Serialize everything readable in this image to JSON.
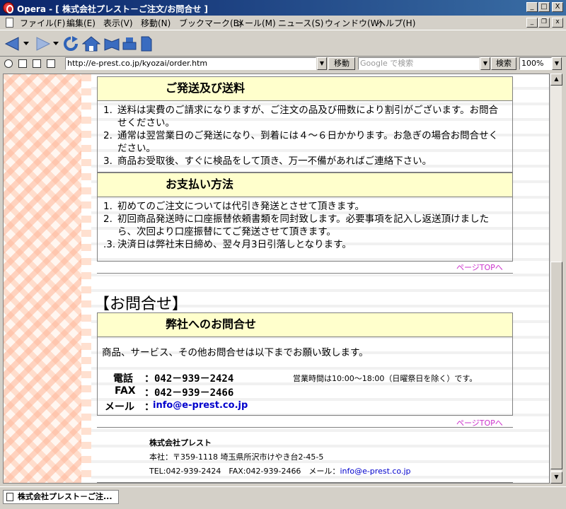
{
  "window": {
    "title": "Opera - [ 株式会社プレスト－ご注文/お問合せ ]",
    "controls": {
      "minimize": "_",
      "maximize": "□",
      "close": "X"
    }
  },
  "menu": {
    "items": [
      "ファイル(F)",
      "編集(E)",
      "表示(V)",
      "移動(N)",
      "ブックマーク(B)",
      "メール(M)",
      "ニュース(S)",
      "ウィンドウ(W)",
      "ヘルプ(H)"
    ]
  },
  "address_bar": {
    "url": "http://e-prest.co.jp/kyozai/order.htm",
    "go_label": "移動",
    "search_placeholder": "Google で検索",
    "search_label": "検索",
    "zoom": "100%"
  },
  "shipping": {
    "heading": "ご発送及び送料",
    "items": [
      {
        "num": "1.",
        "text": "送料は実費のご請求になりますが、ご注文の品及び冊数により割引がございます。お問合せください。"
      },
      {
        "num": "2.",
        "text": "通常は翌営業日のご発送になり、到着には４～６日かかります。お急ぎの場合お問合せください。"
      },
      {
        "num": "3.",
        "text": "商品お受取後、すぐに検品をして頂き、万一不備があればご連絡下さい。"
      }
    ]
  },
  "payment": {
    "heading": "お支払い方法",
    "items": [
      {
        "num": "1.",
        "text": "初めてのご注文については代引き発送とさせて頂きます。"
      },
      {
        "num": "2.",
        "text": "初回商品発送時に口座振替依頼書類を同封致します。必要事項を記入し返送頂けましたら、次回より口座振替にてご発送させて頂きます。"
      },
      {
        "num": ".3.",
        "text": "決済日は弊社末日締め、翌々月3日引落しとなります。"
      }
    ]
  },
  "page_top_label": "ページTOPへ",
  "inquiry": {
    "section_title": "【お問合せ】",
    "heading": "弊社へのお問合せ",
    "intro": "商品、サービス、その他お問合せは以下までお願い致します。",
    "tel_label": "電話",
    "tel": "：042－939－2424",
    "hours": "営業時間は10:00～18:00（日曜祭日を除く）です。",
    "fax_label": "FAX",
    "fax": "：042－939－2466",
    "mail_label": "メール",
    "mail_sep": "：",
    "mail": "info@e-prest.co.jp"
  },
  "footer": {
    "company": "株式会社プレスト",
    "address": "本社：〒359-1118 埼玉県所沢市けやき台2-45-5",
    "contact_text": "TEL:042-939-2424　FAX:042-939-2466　メール：",
    "mail": "info@e-prest.co.jp"
  },
  "status_bar": {
    "tab_title": "株式会社プレスト－ご注..."
  }
}
